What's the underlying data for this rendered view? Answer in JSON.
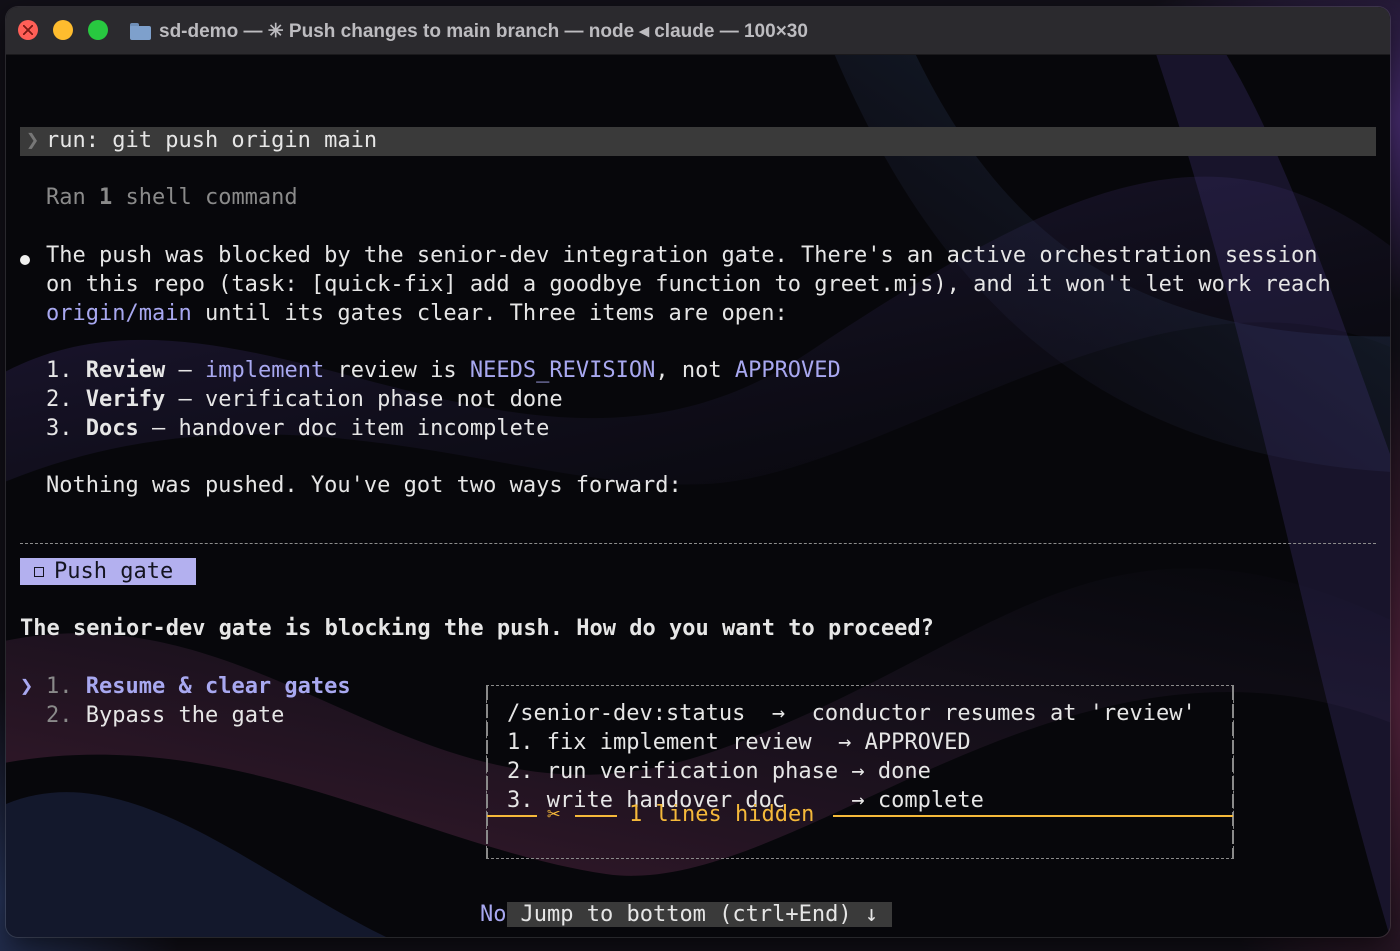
{
  "window": {
    "title": "sd-demo — ✳ Push changes to main branch — node ◂ claude — 100×30"
  },
  "command": {
    "chevron": "❯",
    "text": "run: git push origin main",
    "summary_prefix": "Ran ",
    "summary_count": "1",
    "summary_suffix": " shell command"
  },
  "message": {
    "line1": "The push was blocked by the senior-dev integration gate. There's an active orchestration session",
    "line2": "on this repo (task: [quick-fix] add a goodbye function to greet.mjs), and it won't let work reach",
    "line3_link": "origin/main",
    "line3_rest": " until its gates clear. Three items are open:",
    "items": [
      {
        "num": "1. ",
        "title": "Review",
        "dash": " – ",
        "p1": "implement",
        "p2": " review is ",
        "p3": "NEEDS_REVISION",
        "p4": ", not ",
        "p5": "APPROVED"
      },
      {
        "num": "2. ",
        "title": "Verify",
        "dash": " – ",
        "text": "verification phase not done"
      },
      {
        "num": "3. ",
        "title": "Docs",
        "dash": " – ",
        "text": "handover doc item incomplete"
      }
    ],
    "closing": "Nothing was pushed. You've got two ways forward:"
  },
  "prompt": {
    "badge": "Push gate",
    "question": "The senior-dev gate is blocking the push. How do you want to proceed?",
    "selector": "❯",
    "options": [
      {
        "num": "1. ",
        "label": "Resume & clear gates"
      },
      {
        "num": "2. ",
        "label": "Bypass the gate"
      }
    ]
  },
  "preview": {
    "lines": [
      "/senior-dev:status  →  conductor resumes at 'review'",
      "1. fix implement review  → APPROVED",
      "2. run verification phase → done",
      "3. write handover doc     → complete"
    ],
    "hidden_scissors": "✂",
    "hidden_text": "1 lines hidden"
  },
  "footer": {
    "peek": "No",
    "jump_label": "Jump to bottom (ctrl+End) ↓"
  },
  "colors": {
    "accent_lavender": "#a8a8f0",
    "badge_bg": "#b3b0ef",
    "hidden_orange": "#f5b93a",
    "command_bar": "#3a3a3a"
  }
}
